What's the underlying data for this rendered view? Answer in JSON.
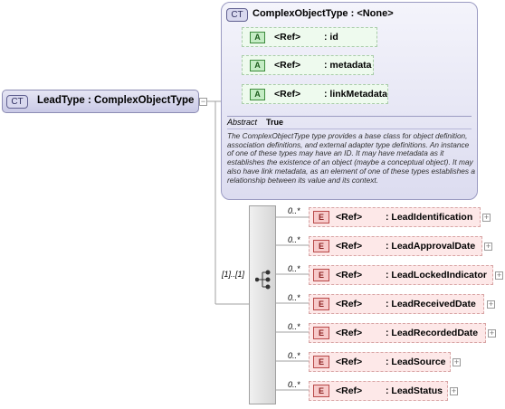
{
  "root": {
    "badge": "CT",
    "label": "LeadType : ComplexObjectType"
  },
  "base_type": {
    "badge": "CT",
    "title": "ComplexObjectType : <None>",
    "attributes": [
      {
        "badge": "A",
        "ref": "<Ref>",
        "name": ": id"
      },
      {
        "badge": "A",
        "ref": "<Ref>",
        "name": ": metadata"
      },
      {
        "badge": "A",
        "ref": "<Ref>",
        "name": ": linkMetadata"
      }
    ],
    "abstract_label": "Abstract",
    "abstract_value": "True",
    "documentation": "The ComplexObjectType type provides a base class for object definition, association definitions, and external adapter type definitions. An instance of one of these types may have an ID. It may have metadata as it establishes the existence of an object (maybe a conceptual object). It may also have link metadata, as an element of one of these types establishes a relationship between its value and its context."
  },
  "sequence": {
    "cardinality": "[1]..[1]"
  },
  "elements": [
    {
      "badge": "E",
      "ref": "<Ref>",
      "name": ": LeadIdentification",
      "cardinality": "0..*"
    },
    {
      "badge": "E",
      "ref": "<Ref>",
      "name": ": LeadApprovalDate",
      "cardinality": "0..*"
    },
    {
      "badge": "E",
      "ref": "<Ref>",
      "name": ": LeadLockedIndicator",
      "cardinality": "0..*"
    },
    {
      "badge": "E",
      "ref": "<Ref>",
      "name": ": LeadReceivedDate",
      "cardinality": "0..*"
    },
    {
      "badge": "E",
      "ref": "<Ref>",
      "name": ": LeadRecordedDate",
      "cardinality": "0..*"
    },
    {
      "badge": "E",
      "ref": "<Ref>",
      "name": ": LeadSource",
      "cardinality": "0..*"
    },
    {
      "badge": "E",
      "ref": "<Ref>",
      "name": ": LeadStatus",
      "cardinality": "0..*"
    }
  ]
}
